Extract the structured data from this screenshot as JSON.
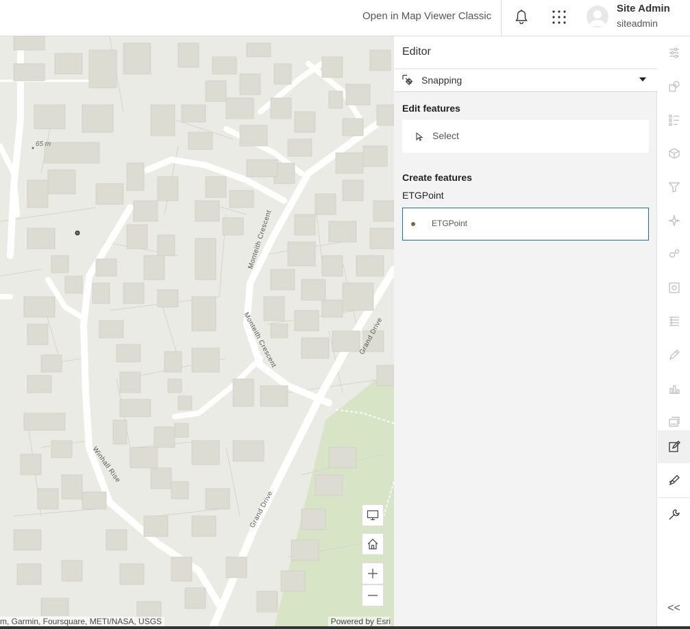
{
  "header": {
    "open_classic_label": "Open in Map Viewer Classic",
    "user_name": "Site Admin",
    "user_id": "siteadmin",
    "icons": [
      "bell-icon",
      "app-launcher-icon",
      "avatar-icon"
    ]
  },
  "map": {
    "elevation_label": "65 m",
    "street_labels": [
      "Monteith Crescent",
      "Monteith Crescent",
      "Grand Drive",
      "Grand Drive",
      "Winhall Rise"
    ],
    "attribution": "m, Garmin, Foursquare, METI/NASA, USGS",
    "powered_by": "Powered by Esri",
    "controls": [
      "monitor-icon",
      "home-icon",
      "zoom-in-icon",
      "zoom-out-icon"
    ],
    "colors": {
      "land": "#ebebe5",
      "building": "#dcdcd2",
      "road": "#ffffff",
      "park": "#d7e4c5"
    }
  },
  "editor": {
    "title": "Editor",
    "snapping_label": "Snapping",
    "edit_features_heading": "Edit features",
    "select_label": "Select",
    "create_features_heading": "Create features",
    "layer_name": "ETGPoint",
    "template_label": "ETGPoint",
    "accent_color": "#1a6fa0"
  },
  "actionbar": {
    "items": [
      "properties-icon",
      "basemap-icon",
      "legend-icon",
      "layers-3d-icon",
      "filter-icon",
      "effects-icon",
      "analysis-icon",
      "settings-gear-icon",
      "tables-icon",
      "sketch-icon",
      "charts-icon",
      "media-icon",
      "edit-icon",
      "draw-icon",
      "tools-icon"
    ],
    "active": "edit-icon",
    "collapse_label": "<<"
  }
}
